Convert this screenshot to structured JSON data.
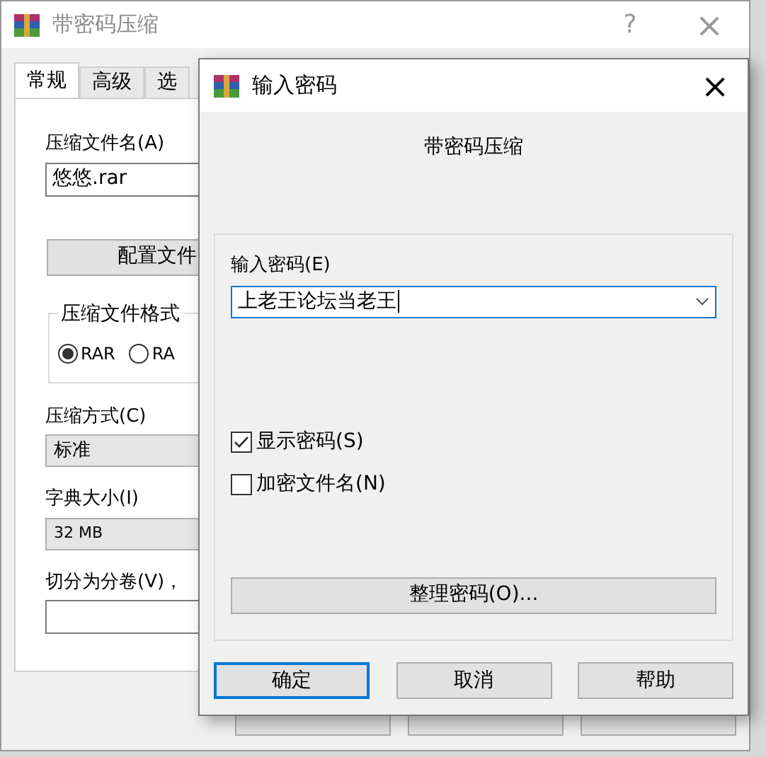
{
  "back_window": {
    "title": "带密码压缩",
    "help": "?",
    "close": "×",
    "tabs": [
      {
        "label": "常规",
        "selected": true
      },
      {
        "label": "高级",
        "selected": false
      },
      {
        "label": "选",
        "selected": false
      }
    ],
    "archive_name_label": "压缩文件名(A)",
    "archive_name": "悠悠.rar",
    "profiles_button": "配置文件",
    "format_group": "压缩文件格式",
    "formats": [
      {
        "label": "RAR",
        "selected": true
      },
      {
        "label": "RA",
        "selected": false
      }
    ],
    "method_label": "压缩方式(C)",
    "method": "标准",
    "dict_label": "字典大小(I)",
    "dict": "32 MB",
    "split_label": "切分为分卷(V)，"
  },
  "dialog": {
    "title": "输入密码",
    "close": "×",
    "subtitle": "带密码压缩",
    "password_label": "输入密码(E)",
    "password": "上老王论坛当老王",
    "options": [
      {
        "label": "显示密码(S)",
        "checked": true
      },
      {
        "label": "加密文件名(N)",
        "checked": false
      }
    ],
    "organize_button": "整理密码(O)...",
    "buttons": [
      {
        "label": "确定",
        "selected": true
      },
      {
        "label": "取消",
        "selected": false
      },
      {
        "label": "帮助",
        "selected": false
      }
    ]
  }
}
